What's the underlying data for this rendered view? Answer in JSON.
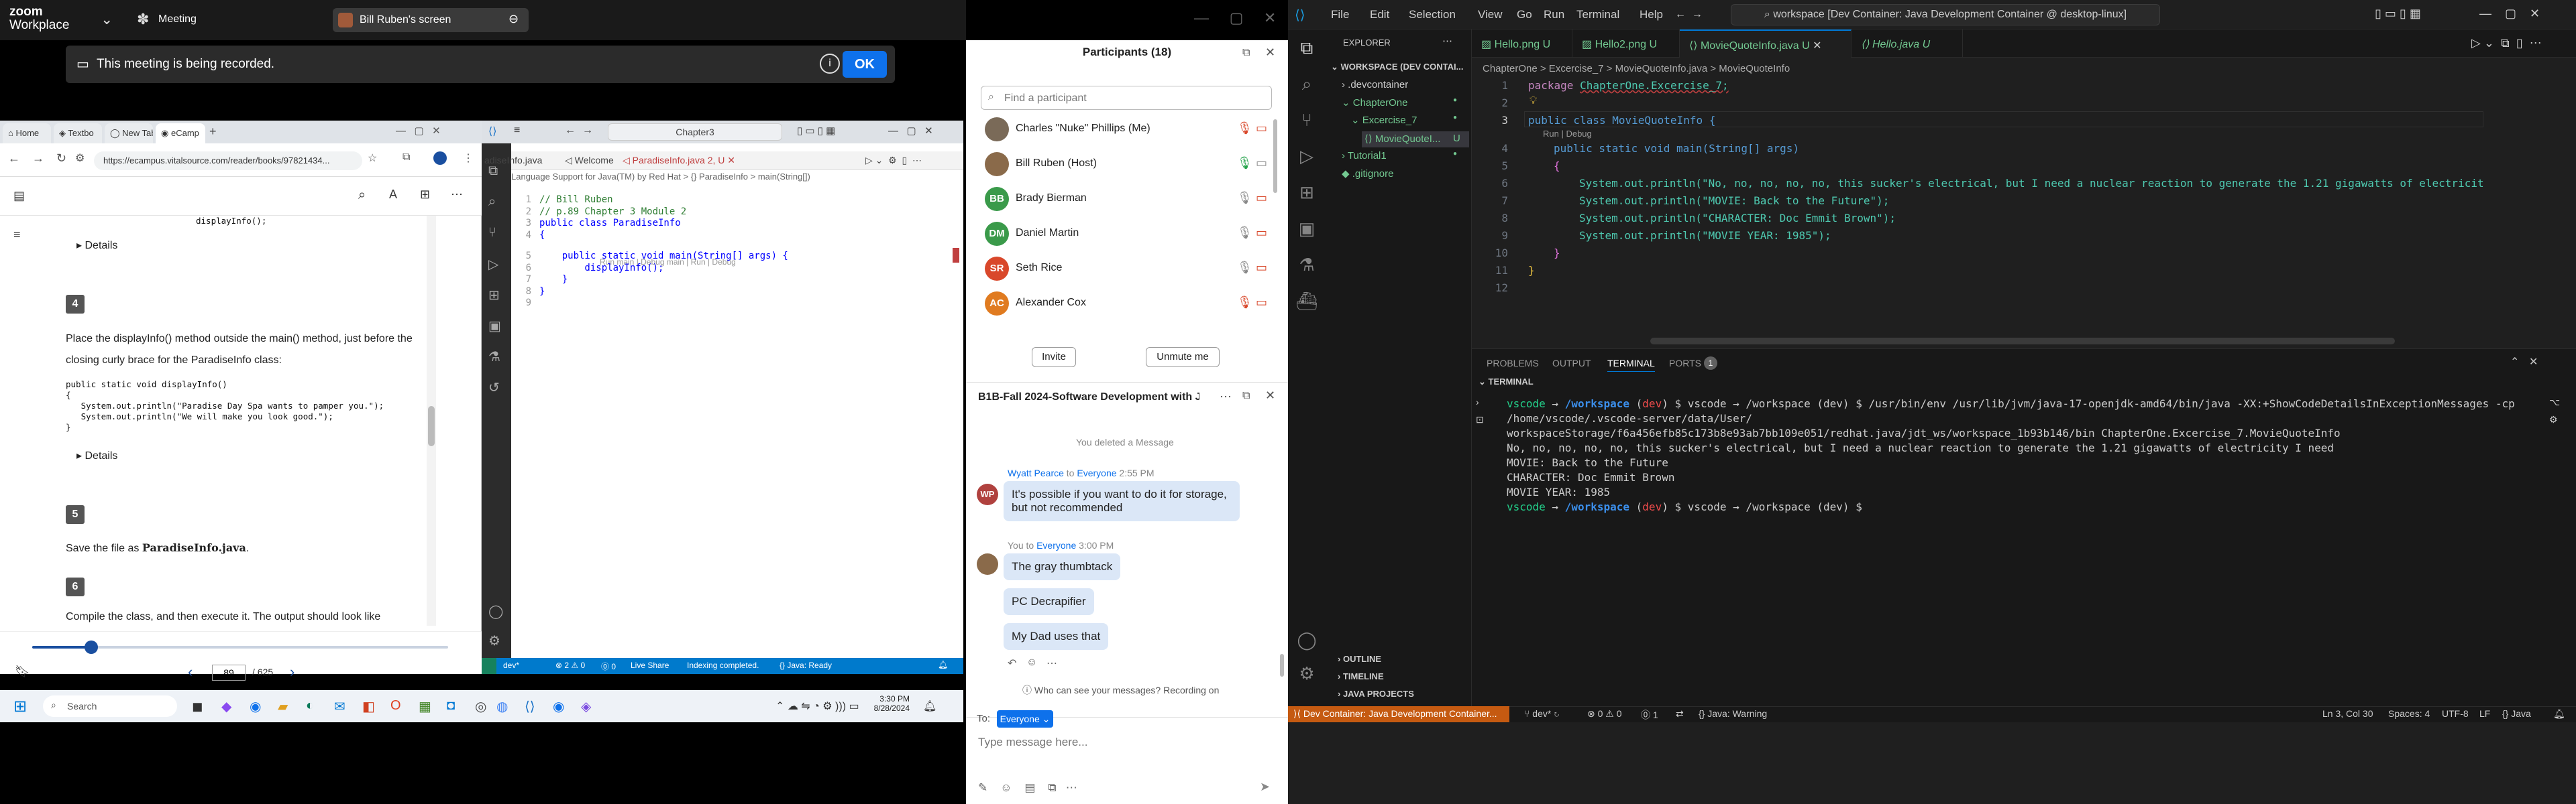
{
  "zoom": {
    "logo_line1": "zoom",
    "logo_line2": "Workplace",
    "meeting_label": "Meeting",
    "share_label": "Bill Ruben's screen",
    "recording_text": "This meeting is being recorded.",
    "ok_label": "OK"
  },
  "browser": {
    "tabs": [
      "Home",
      "Textbo",
      "New Tab",
      "eCamp"
    ],
    "url": "https://ecampus.vitalsource.com/reader/books/97821434...",
    "content": {
      "code_top": "displayInfo();",
      "details1": "Details",
      "step4_num": "4",
      "step4_text": "Place the displayInfo() method outside the main() method, just before the closing curly brace for the ParadiseInfo class:",
      "code_block": "public static void displayInfo()\n{\n   System.out.println(\"Paradise Day Spa wants to pamper you.\");\n   System.out.println(\"We will make you look good.\");\n}",
      "details2": "Details",
      "step5_num": "5",
      "step5_pre": "Save the file as ",
      "step5_bold": "ParadiseInfo.java",
      "step5_post": ".",
      "step6_num": "6",
      "step6_text": "Compile the class, and then execute it. The output should look like"
    },
    "page_current": "89",
    "page_total": "/ 625",
    "page_progress_fraction": 0.142
  },
  "vs_small": {
    "search": "Chapter3",
    "tabs": [
      "Welcome",
      "ParadiseInfo.java 2, U"
    ],
    "left_tab_partial": "adiseInfo.java",
    "breadcrumb": "Language Support for Java(TM) by Red Hat  >  {} ParadiseInfo  >  main(String[])",
    "codelens": "Run main | Debug main | Run | Debug",
    "lines": [
      {
        "n": "1",
        "t": "// Bill Ruben"
      },
      {
        "n": "2",
        "t": "// p.89 Chapter 3 Module 2"
      },
      {
        "n": "3",
        "t": "public class ParadiseInfo"
      },
      {
        "n": "4",
        "t": "{"
      },
      {
        "n": "5",
        "t": "    public static void main(String[] args) {"
      },
      {
        "n": "6",
        "t": "        displayInfo();"
      },
      {
        "n": "7",
        "t": "    }"
      },
      {
        "n": "8",
        "t": "}"
      },
      {
        "n": "9",
        "t": ""
      }
    ],
    "status": [
      "dev*",
      "⊗ 2 ⚠ 0",
      "⓪ 0",
      "Live Share",
      "Indexing completed.",
      "{} Java: Ready"
    ]
  },
  "taskbar": {
    "search": "Search",
    "time": "3:30 PM",
    "date": "8/28/2024"
  },
  "participants": {
    "title": "Participants (18)",
    "search_placeholder": "Find a participant",
    "people": [
      {
        "name": "Charles \"Nuke\" Phillips (Me)",
        "initials": "",
        "color": "#7a6a58"
      },
      {
        "name": "Bill Ruben (Host)",
        "initials": "",
        "color": "#8a6a4a"
      },
      {
        "name": "Brady Bierman",
        "initials": "BB",
        "color": "#3a9a4a"
      },
      {
        "name": "Daniel Martin",
        "initials": "DM",
        "color": "#3a9a4a"
      },
      {
        "name": "Seth Rice",
        "initials": "SR",
        "color": "#d9482b"
      },
      {
        "name": "Alexander Cox",
        "initials": "AC",
        "color": "#e07b20"
      }
    ],
    "invite": "Invite",
    "unmute_me": "Unmute me"
  },
  "chat": {
    "title": "B1B-Fall 2024-Software Development with J...",
    "deleted": "You deleted a Message",
    "msg1_sender": "Wyatt Pearce",
    "msg1_to": "to",
    "msg1_target": "Everyone",
    "msg1_time": "2:55 PM",
    "msg1_initials": "WP",
    "msg1_text": "It's possible if you want to do it for storage, but not recommended",
    "msg2_sender": "You",
    "msg2_to": "to",
    "msg2_target": "Everyone",
    "msg2_time": "3:00 PM",
    "my_msgs": [
      "The gray thumbtack",
      "PC Decrapifier",
      "My Dad uses that"
    ],
    "privacy": "Who can see your messages? Recording on",
    "to_label": "To:",
    "to_target": "Everyone",
    "placeholder": "Type message here..."
  },
  "vscode": {
    "menus": [
      "File",
      "Edit",
      "Selection",
      "View",
      "Go",
      "Run",
      "Terminal",
      "Help"
    ],
    "command": "workspace [Dev Container: Java Development Container @ desktop-linux]",
    "explorer": "EXPLORER",
    "workspace": "WORKSPACE (DEV CONTAI...",
    "tree": [
      ".devcontainer",
      "ChapterOne",
      "Excercise_7",
      "MovieQuoteI...",
      "Tutorial1",
      ".gitignore"
    ],
    "tree_badge": "U",
    "tabs": [
      {
        "label": "Hello.png",
        "badge": "U"
      },
      {
        "label": "Hello2.png",
        "badge": "U"
      },
      {
        "label": "MovieQuoteInfo.java",
        "badge": "U"
      },
      {
        "label": "Hello.java",
        "badge": "U"
      }
    ],
    "breadcrumb": "ChapterOne  >  Excercise_7  >  MovieQuoteInfo.java  >  MovieQuoteInfo",
    "codelens": "Run | Debug",
    "code": {
      "l1_kw": "package",
      "l1_rest": "ChapterOne.Excercise_7;",
      "l3": "public class MovieQuoteInfo {",
      "l4": "public static void main(String[] args)",
      "l5": "{",
      "l6": "System.out.println(\"No, no, no, no, no, this sucker's electrical, but I need a nuclear reaction to generate the 1.21 gigawatts of electricit",
      "l7": "System.out.println(\"MOVIE: Back to the Future\");",
      "l8": "System.out.println(\"CHARACTER: Doc Emmit Brown\");",
      "l9": "System.out.println(\"MOVIE YEAR: 1985\");",
      "l10": "}",
      "l11": "}"
    },
    "panel_tabs": [
      "PROBLEMS",
      "OUTPUT",
      "TERMINAL",
      "PORTS"
    ],
    "ports_count": "1",
    "terminal_label": "TERMINAL",
    "terminal": [
      "vscode → /workspace (dev) $  /usr/bin/env /usr/lib/jvm/java-17-openjdk-amd64/bin/java -XX:+ShowCodeDetailsInExceptionMessages -cp /home/vscode/.vscode-server/data/User/",
      "workspaceStorage/f6a456efb85c173b8e93ab7bb109e051/redhat.java/jdt_ws/workspace_1b93b146/bin ChapterOne.Excercise_7.MovieQuoteInfo",
      "No, no, no, no, no, this sucker's electrical, but I need a nuclear reaction to generate the 1.21 gigawatts of electricity I need",
      "MOVIE: Back to the Future",
      "CHARACTER: Doc Emmit Brown",
      "MOVIE YEAR: 1985",
      "vscode → /workspace (dev) $"
    ],
    "outline": [
      "OUTLINE",
      "TIMELINE",
      "JAVA PROJECTS"
    ],
    "status_remote": "Dev Container: Java Development Container...",
    "status_items": [
      "dev*",
      "⊗ 0 ⚠ 0",
      "⓪ 1",
      "{} Java: Warning"
    ],
    "status_right": [
      "Ln 3, Col 30",
      "Spaces: 4",
      "UTF-8",
      "LF",
      "{} Java"
    ]
  }
}
